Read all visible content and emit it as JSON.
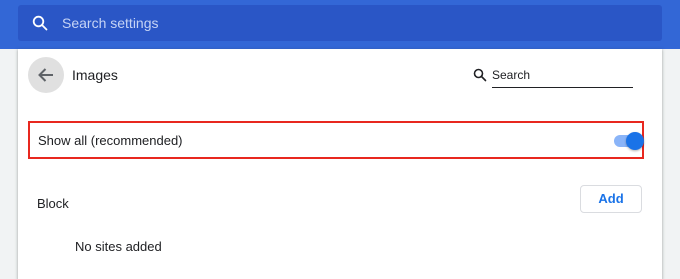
{
  "header": {
    "search_placeholder": "Search settings",
    "search_icon": "search-icon"
  },
  "page": {
    "title": "Images",
    "back_icon": "arrow-back-icon",
    "search_label": "Search",
    "search_icon": "search-icon"
  },
  "show_all": {
    "label": "Show all (recommended)",
    "enabled": true
  },
  "block": {
    "title": "Block",
    "add_label": "Add",
    "empty_text": "No sites added"
  },
  "colors": {
    "header_bg": "#3367d6",
    "search_bg": "#2a56c6",
    "accent": "#1a73e8",
    "highlight_border": "#e8281f"
  }
}
